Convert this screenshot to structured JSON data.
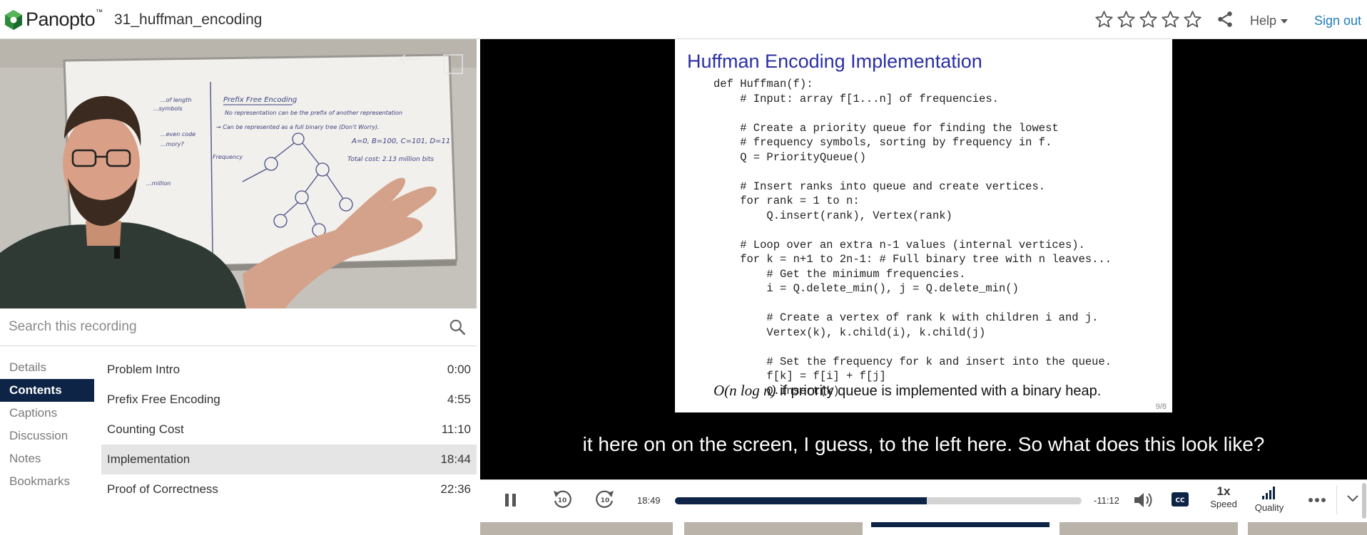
{
  "header": {
    "brand": "Panopto",
    "brand_mark": "™",
    "recording_title": "31_huffman_encoding",
    "rating_stars": 5,
    "help_label": "Help",
    "signout_label": "Sign out"
  },
  "search": {
    "placeholder": "Search this recording"
  },
  "side_tabs": [
    {
      "label": "Details"
    },
    {
      "label": "Contents"
    },
    {
      "label": "Captions"
    },
    {
      "label": "Discussion"
    },
    {
      "label": "Notes"
    },
    {
      "label": "Bookmarks"
    }
  ],
  "active_tab": "Contents",
  "contents": [
    {
      "title": "Problem Intro",
      "time": "0:00"
    },
    {
      "title": "Prefix Free Encoding",
      "time": "4:55"
    },
    {
      "title": "Counting Cost",
      "time": "11:10"
    },
    {
      "title": "Implementation",
      "time": "18:44"
    },
    {
      "title": "Proof of Correctness",
      "time": "22:36"
    }
  ],
  "selected_content": "Implementation",
  "whiteboard": {
    "heading": "Prefix Free Encoding",
    "line1": "No representation can be the prefix of another representation",
    "line2": "→ Can be represented as a full binary tree (Don't Worry).",
    "codes": "A=0, B=100, C=101, D=11",
    "total": "Total cost: 2.13 million bits",
    "left_frag1": "...of length",
    "left_frag2": "...symbols",
    "left_frag3": "...even code",
    "left_frag4": "...mory?",
    "left_frag5": "...million",
    "freq": "Frequency"
  },
  "slide": {
    "title": "Huffman Encoding Implementation",
    "code": "def Huffman(f):\n    # Input: array f[1...n] of frequencies.\n\n    # Create a priority queue for finding the lowest\n    # frequency symbols, sorting by frequency in f.\n    Q = PriorityQueue()\n\n    # Insert ranks into queue and create vertices.\n    for rank = 1 to n:\n        Q.insert(rank), Vertex(rank)\n\n    # Loop over an extra n-1 values (internal vertices).\n    for k = n+1 to 2n-1: # Full binary tree with n leaves...\n        # Get the minimum frequencies.\n        i = Q.delete_min(), j = Q.delete_min()\n\n        # Create a vertex of rank k with children i and j.\n        Vertex(k), k.child(i), k.child(j)\n\n        # Set the frequency for k and insert into the queue.\n        f[k] = f[i] + f[j]\n        Q.insert(k)",
    "complexity_math": "O(n log n)",
    "complexity_text": " if priority queue is implemented with a binary heap.",
    "page": "9/8"
  },
  "caption": "it here on on the screen, I guess, to the left here. So what does this look like?",
  "controls": {
    "elapsed": "18:49",
    "remaining": "-11:12",
    "progress": 0.62,
    "speed_value": "1x",
    "speed_label": "Speed",
    "quality_label": "Quality",
    "cc_label": "CC",
    "skip_back": "10",
    "skip_forward": "10"
  },
  "colors": {
    "accent_navy": "#0d2446",
    "link_blue": "#1f7bbf",
    "slide_title_blue": "#2b2fa3",
    "logo_green": "#2e8b3e"
  }
}
